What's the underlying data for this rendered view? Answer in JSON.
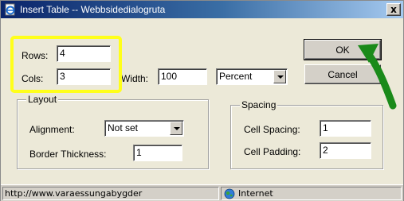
{
  "window": {
    "title": "Insert Table -- Webbsidedialogruta",
    "close_glyph": "x"
  },
  "size": {
    "rows_label": "Rows:",
    "rows_value": "4",
    "cols_label": "Cols:",
    "cols_value": "3",
    "width_label": "Width:",
    "width_value": "100",
    "unit_selected": "Percent"
  },
  "buttons": {
    "ok_label": "OK",
    "cancel_label": "Cancel"
  },
  "layout": {
    "legend": "Layout",
    "alignment_label": "Alignment:",
    "alignment_selected": "Not set",
    "border_label": "Border Thickness:",
    "border_value": "1"
  },
  "spacing": {
    "legend": "Spacing",
    "cell_spacing_label": "Cell Spacing:",
    "cell_spacing_value": "1",
    "cell_padding_label": "Cell Padding:",
    "cell_padding_value": "2"
  },
  "status": {
    "url": "http://www.varaessungabygder",
    "zone": "Internet",
    "zone_icon": "globe-icon"
  },
  "annotations": {
    "highlight_color": "#ffff1a",
    "arrow_color": "#1a8a1a"
  }
}
